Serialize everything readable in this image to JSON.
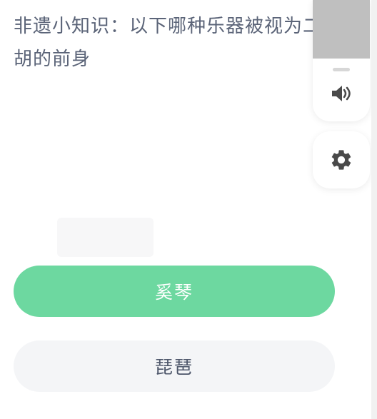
{
  "question": {
    "text": "非遗小知识：以下哪种乐器被视为二胡的前身"
  },
  "options": [
    {
      "label": "奚琴",
      "state": "selected"
    },
    {
      "label": "琵琶",
      "state": "normal"
    }
  ],
  "controls": {
    "volume_icon": "speaker-icon",
    "settings_icon": "gear-icon",
    "volume_level": 0.5
  },
  "colors": {
    "accent": "#6dd8a0",
    "text": "#5b6478",
    "option_bg": "#f4f5f7"
  }
}
